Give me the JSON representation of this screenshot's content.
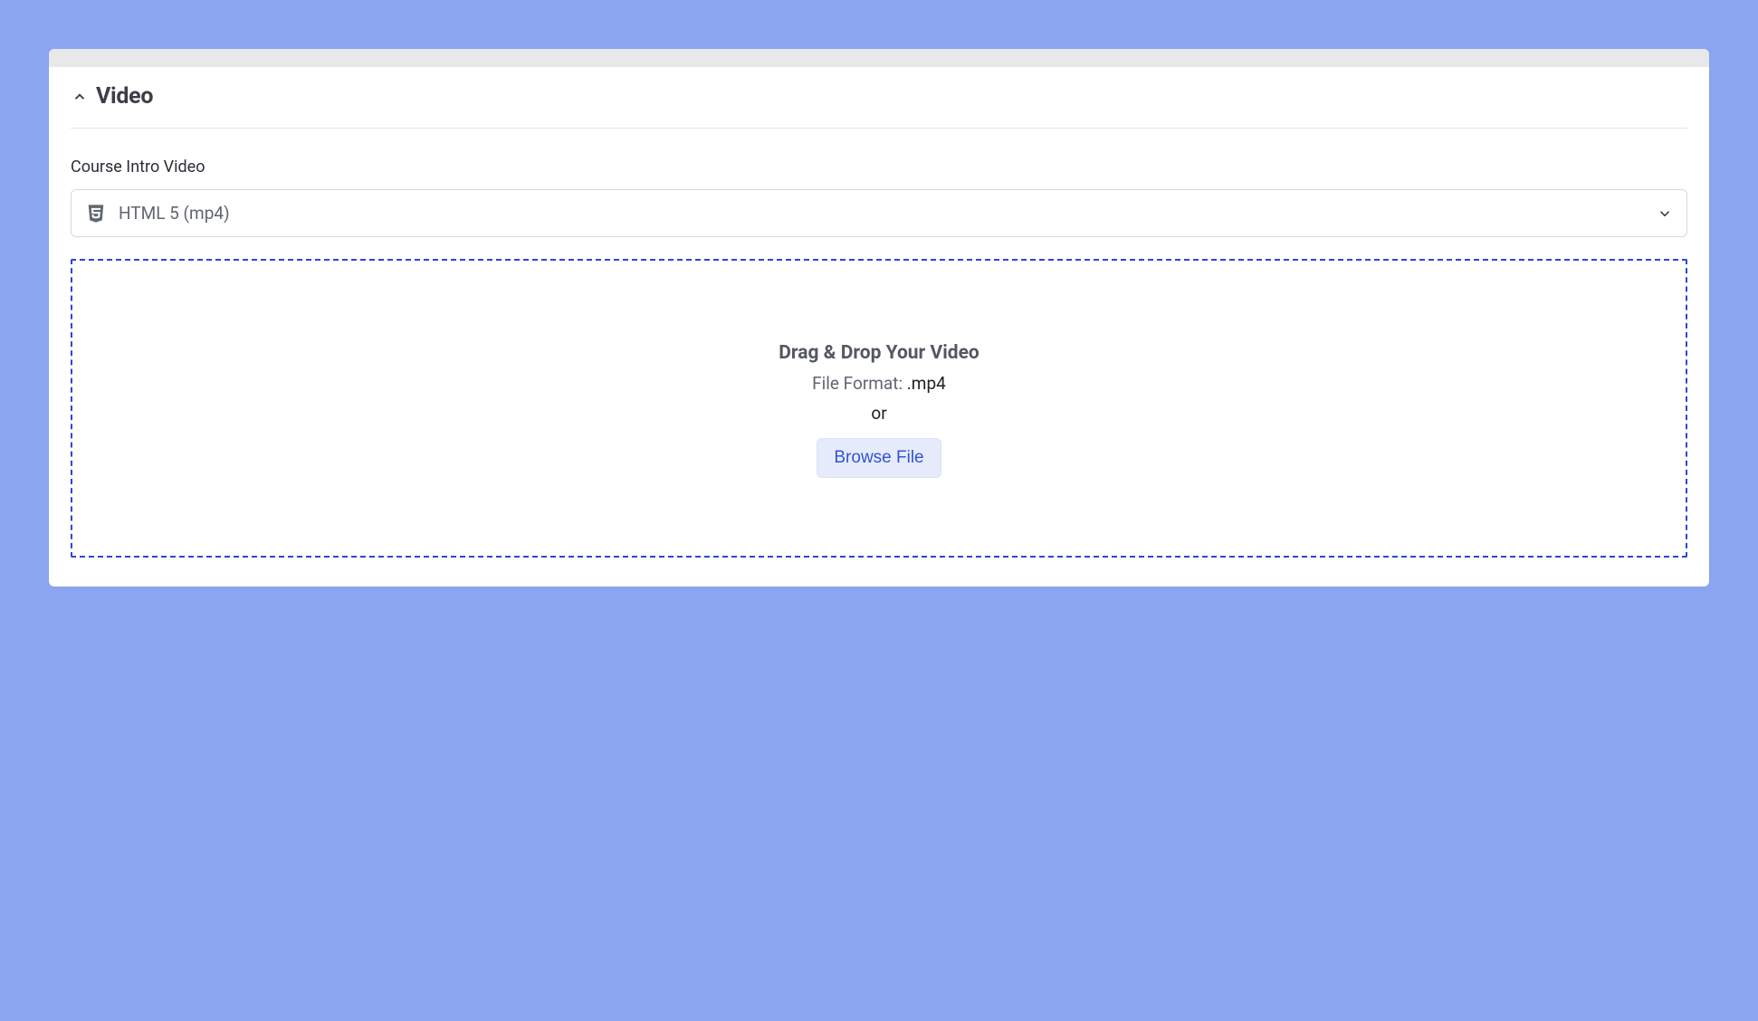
{
  "section": {
    "title": "Video",
    "field_label": "Course Intro Video",
    "select_value": "HTML 5 (mp4)"
  },
  "dropzone": {
    "title": "Drag & Drop Your Video",
    "format_prefix": "File Format: ",
    "format_ext": ".mp4",
    "or": "or",
    "browse_label": "Browse File"
  }
}
